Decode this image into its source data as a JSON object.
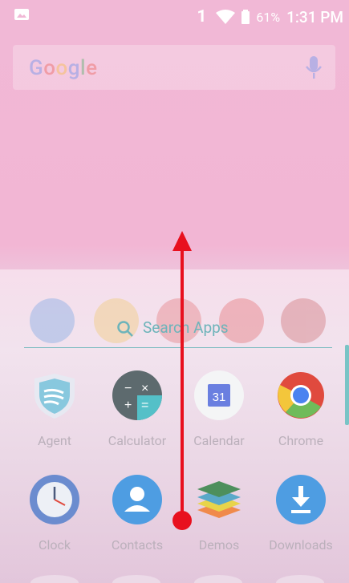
{
  "status_bar": {
    "sim": "1",
    "battery_percent": "61%",
    "time": "1:31 PM"
  },
  "google_bar": {
    "logo": "Google"
  },
  "drawer": {
    "search_placeholder": "Search Apps",
    "row1": [
      {
        "label": "Agent",
        "icon": "shield-icon"
      },
      {
        "label": "Calculator",
        "icon": "calculator-icon"
      },
      {
        "label": "Calendar",
        "icon": "calendar-icon",
        "date": "31"
      },
      {
        "label": "Chrome",
        "icon": "chrome-icon"
      }
    ],
    "row2": [
      {
        "label": "Clock",
        "icon": "clock-icon"
      },
      {
        "label": "Contacts",
        "icon": "contacts-icon"
      },
      {
        "label": "Demos",
        "icon": "layers-icon"
      },
      {
        "label": "Downloads",
        "icon": "download-icon"
      }
    ]
  },
  "gesture": {
    "type": "swipe-up",
    "color": "#e8101e"
  }
}
